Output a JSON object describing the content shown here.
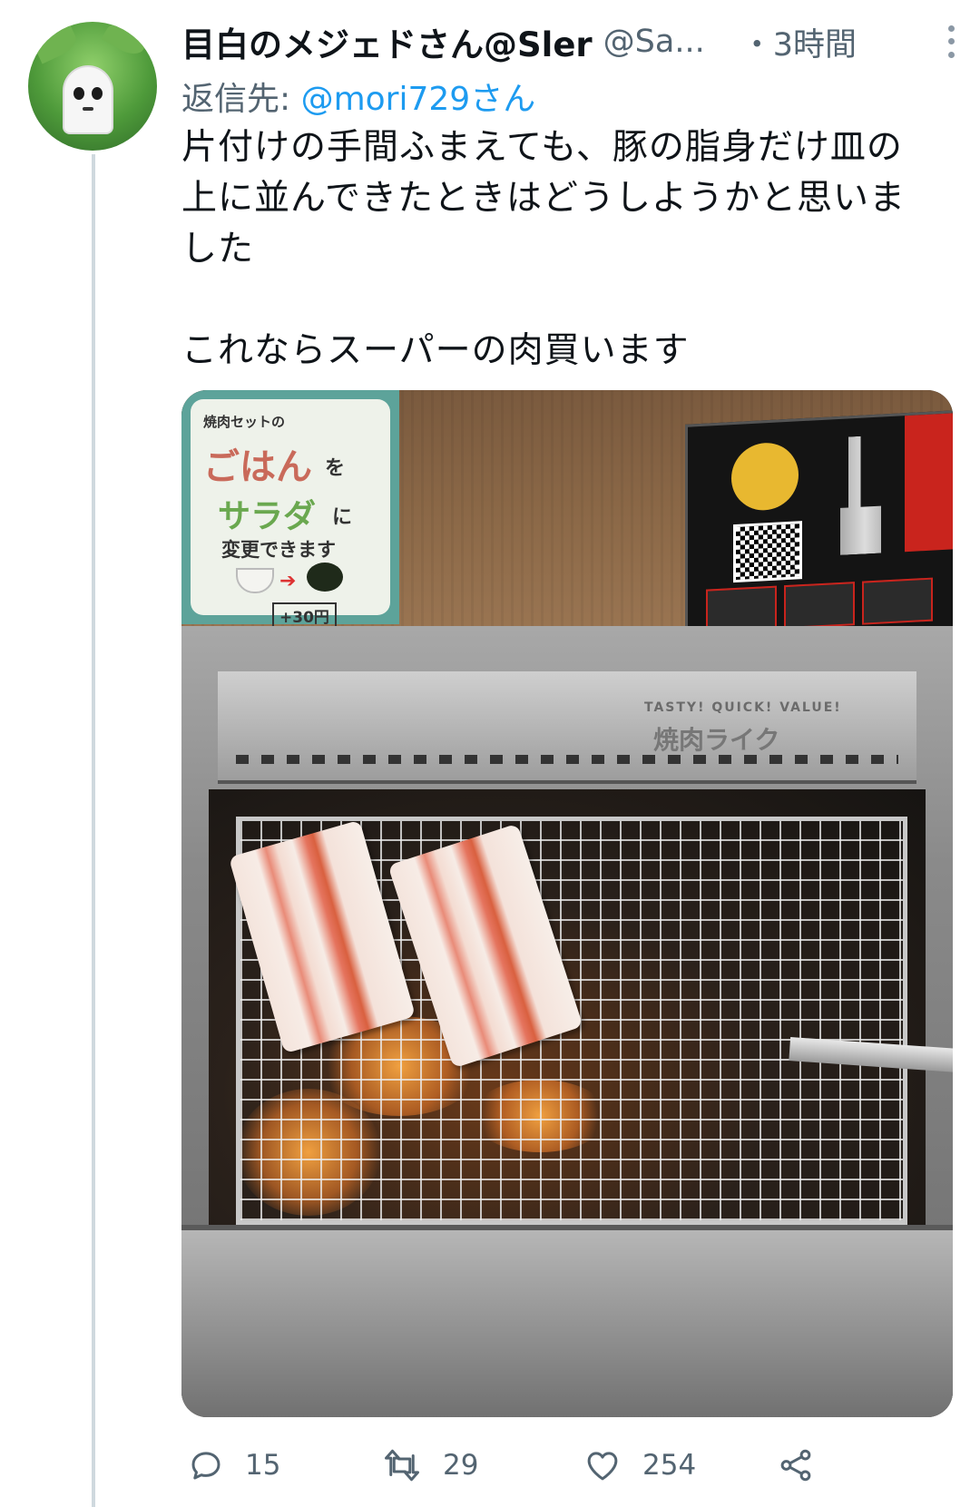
{
  "tweet": {
    "display_name": "目白のメジェドさん@Sler",
    "handle": "@Sa...",
    "time": "・3時間",
    "reply_to_prefix": "返信先: ",
    "reply_to_mention": "@mori729さん",
    "text_lines": [
      "片付けの手間ふまえても、豚の脂身だけ皿の",
      "上に並んできたときはどうしようかと思いま",
      "した",
      "これならスーパーの肉買います"
    ]
  },
  "media": {
    "poster_rice": {
      "small": "焼肉セットの",
      "gohan": "ごはん",
      "wo": "を",
      "salad": "サラダ",
      "ni": "に",
      "change": "変更できます",
      "price": "+30円"
    },
    "grill": {
      "label": "TASTY! QUICK! VALUE!",
      "logo": "焼肉ライク"
    }
  },
  "actions": {
    "reply_count": "15",
    "retweet_count": "29",
    "like_count": "254"
  },
  "colors": {
    "accent": "#1d9bf0",
    "secondary_text": "#536471",
    "thread_line": "#cfd9de"
  },
  "icons": [
    "more-icon",
    "reply-icon",
    "retweet-icon",
    "like-icon",
    "share-icon"
  ]
}
